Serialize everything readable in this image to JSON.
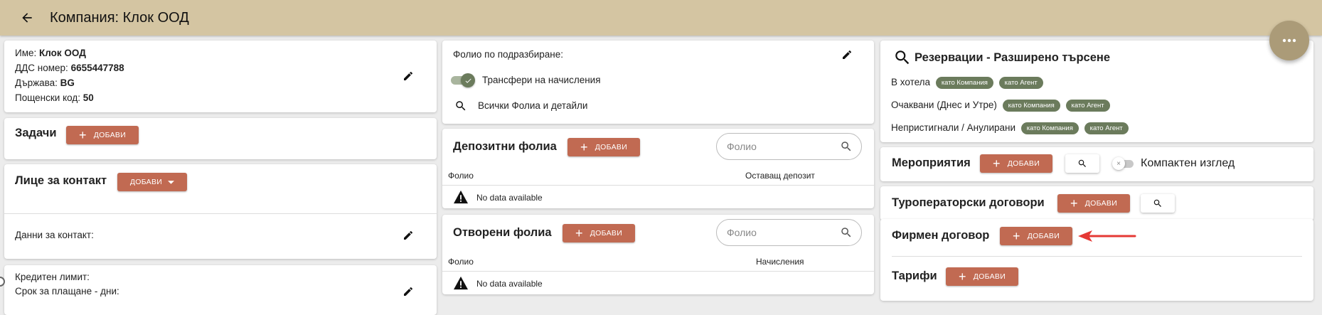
{
  "header": {
    "title": "Компания: Клок ООД"
  },
  "company": {
    "name_label": "Име:",
    "name_value": "Клок ООД",
    "vat_label": "ДДС номер:",
    "vat_value": "6655447788",
    "country_label": "Държава:",
    "country_value": "BG",
    "postcode_label": "Пощенски код:",
    "postcode_value": "50"
  },
  "tasks": {
    "title": "Задачи",
    "add_label": "ДОБАВИ"
  },
  "contact": {
    "title": "Лице за контакт",
    "add_label": "ДОБАВИ",
    "data_label": "Данни за контакт:"
  },
  "credit": {
    "limit_label": "Кредитен лимит:",
    "terms_label": "Срок за плащане - дни:"
  },
  "folio_default": {
    "label": "Фолио по подразбиране:",
    "transfers_label": "Трансфери на начисления",
    "transfers_on": true,
    "all_folios_label": "Всички Фолиа и детайли"
  },
  "deposit_folios": {
    "title": "Депозитни фолиа",
    "add_label": "ДОБАВИ",
    "search_placeholder": "Фолио",
    "columns": [
      "Фолио",
      "Оставащ депозит"
    ],
    "empty_text": "No data available"
  },
  "open_folios": {
    "title": "Отворени фолиа",
    "add_label": "ДОБАВИ",
    "search_placeholder": "Фолио",
    "columns": [
      "Фолио",
      "Начисления"
    ],
    "empty_text": "No data available"
  },
  "reservations": {
    "title": "Резервации - Разширено търсене",
    "rows": [
      {
        "label": "В хотела",
        "chips": [
          "като Компания",
          "като Агент"
        ]
      },
      {
        "label": "Очаквани (Днес и Утре)",
        "chips": [
          "като Компания",
          "като Агент"
        ]
      },
      {
        "label": "Непристигнали / Анулирани",
        "chips": [
          "като Компания",
          "като Агент"
        ]
      }
    ]
  },
  "events": {
    "title": "Мероприятия",
    "add_label": "ДОБАВИ",
    "compact_label": "Компактен изглед",
    "compact_on": false
  },
  "tour_contracts": {
    "title": "Туроператорски договори",
    "add_label": "ДОБАВИ"
  },
  "company_contract": {
    "title": "Фирмен договор",
    "add_label": "ДОБАВИ"
  },
  "tariffs": {
    "title": "Тарифи",
    "add_label": "ДОБАВИ"
  },
  "colors": {
    "accent": "#c16a52",
    "header": "#d4c5a2",
    "chip": "#6b7b5c",
    "arrow": "#e53935"
  }
}
